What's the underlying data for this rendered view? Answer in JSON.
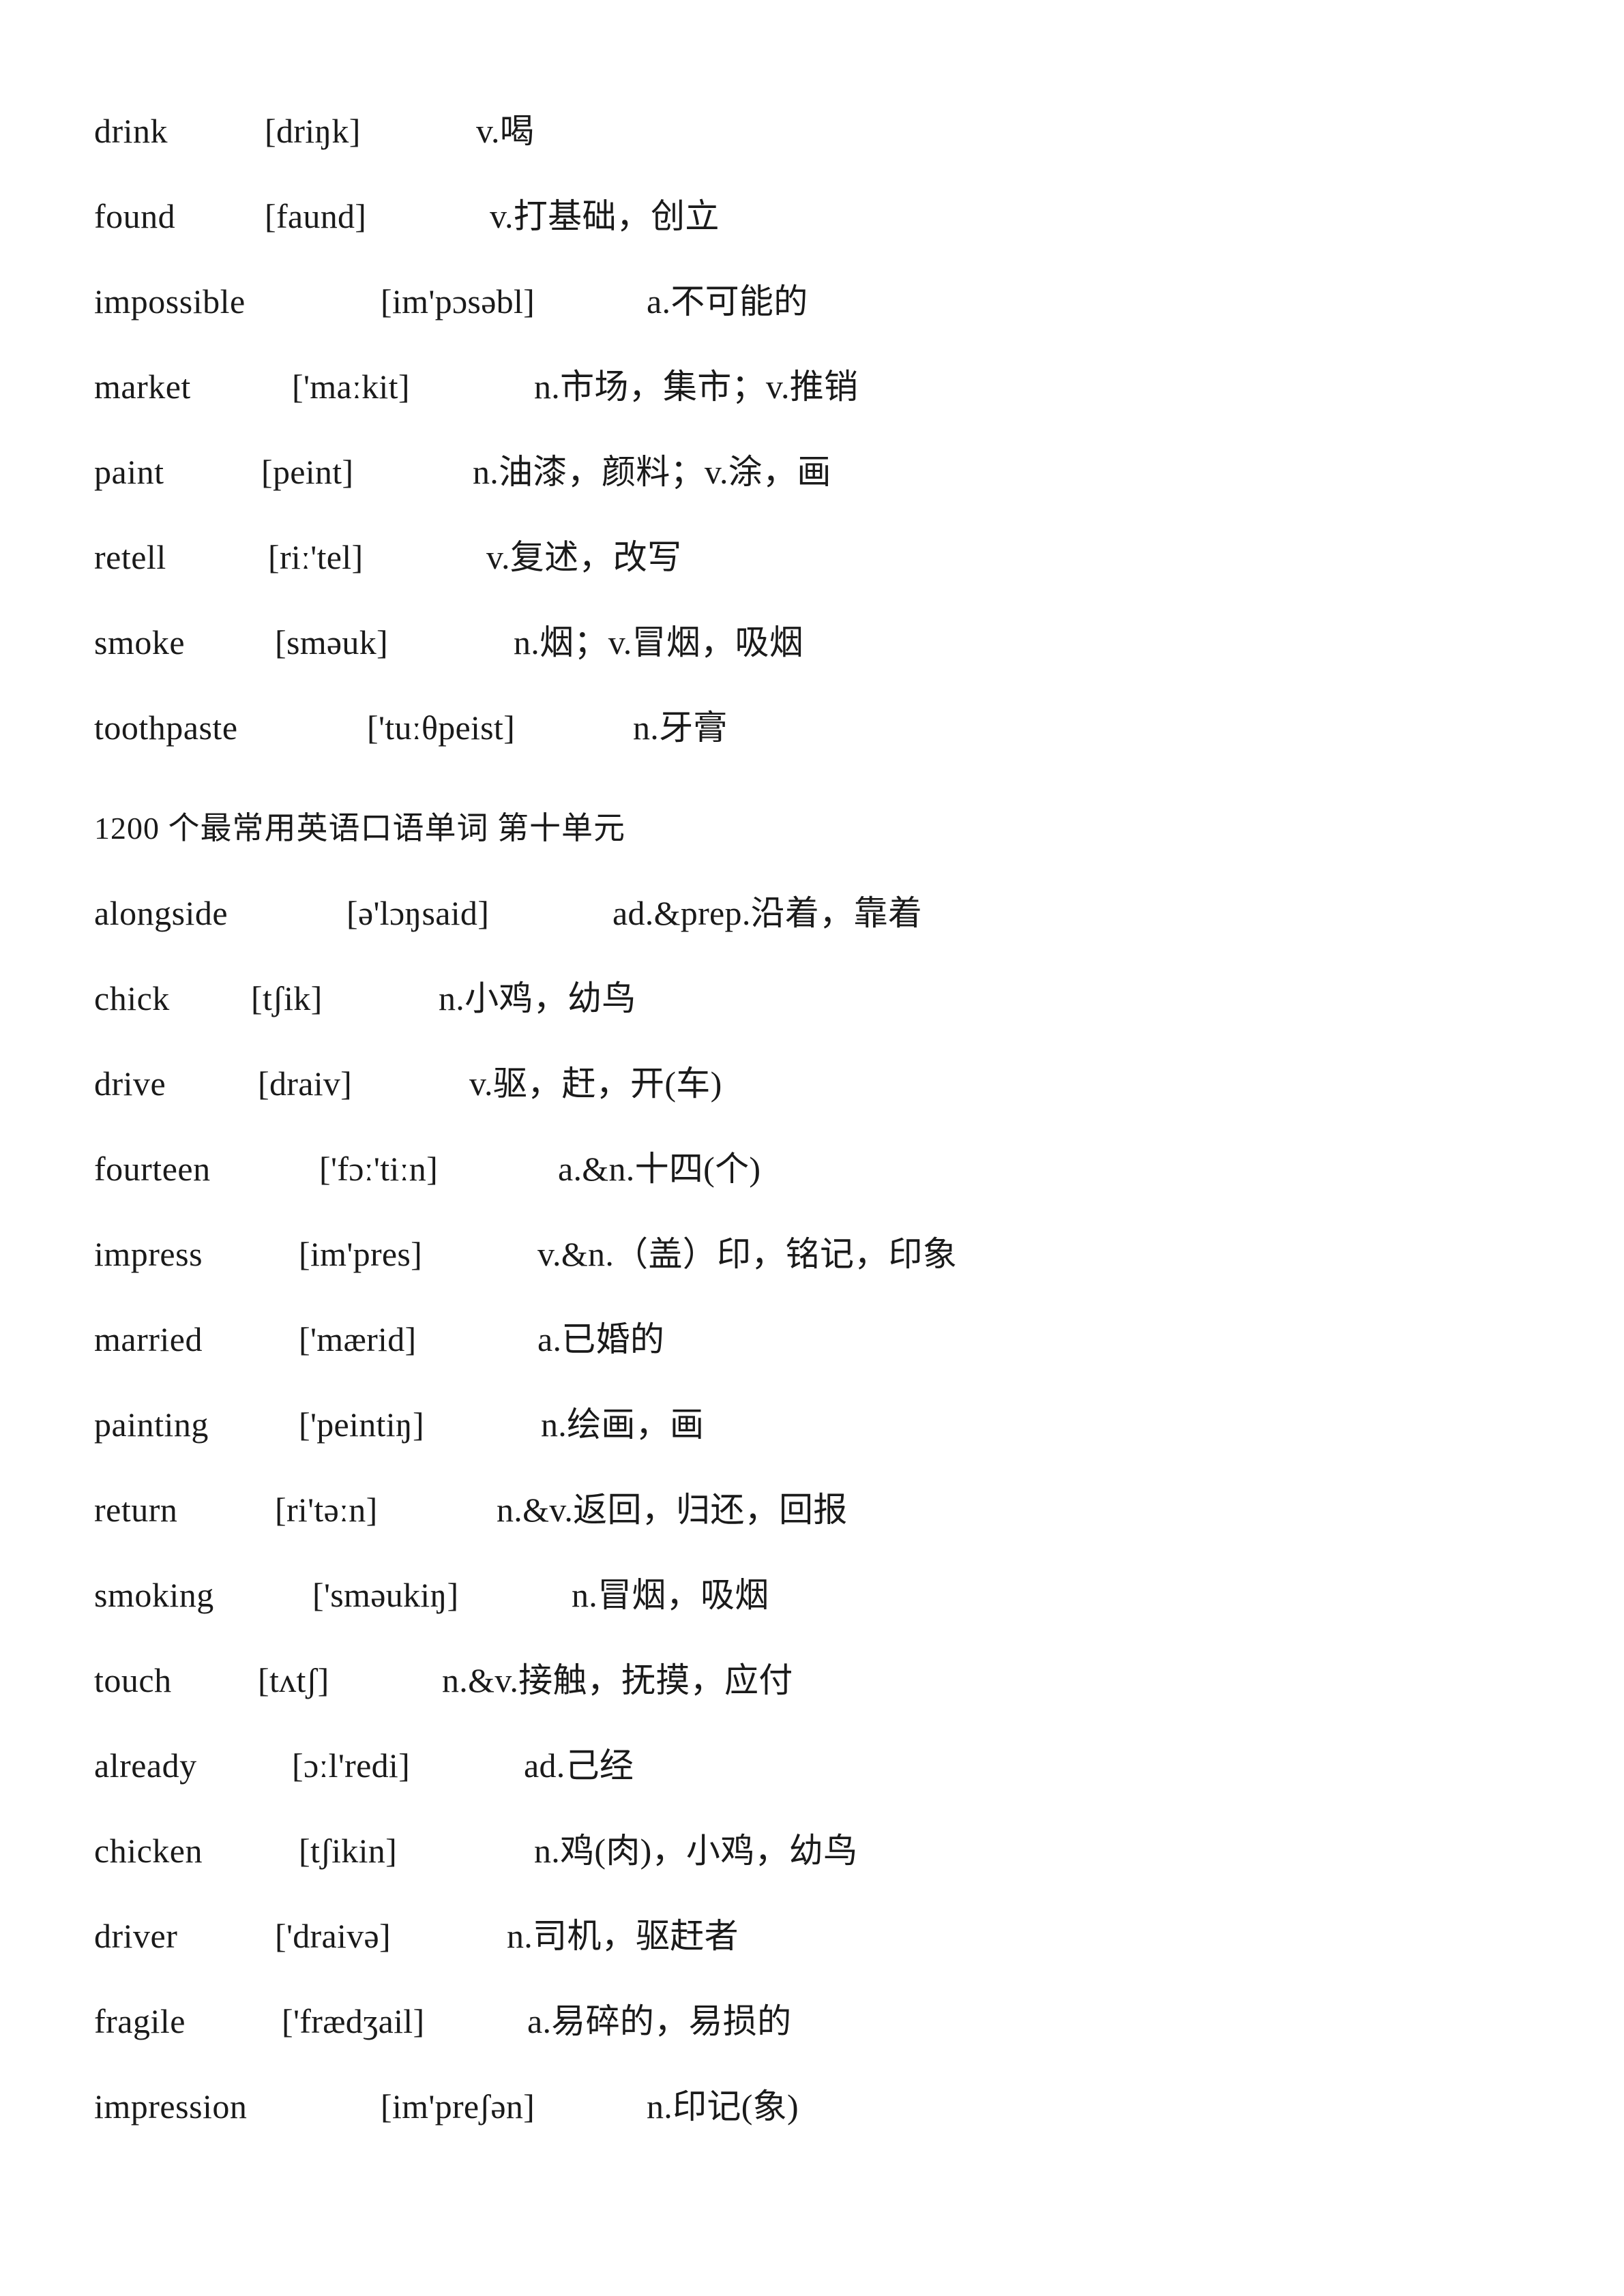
{
  "document": {
    "section_heading": "1200 个最常用英语口语单词 第十单元",
    "groups": [
      {
        "id": "group-top",
        "entries": [
          {
            "word": "drink",
            "phonetic": "[driŋk]",
            "definition": "v.喝",
            "word_w": 250,
            "phon_w": 310
          },
          {
            "word": "found",
            "phonetic": "[faund]",
            "definition": "v.打基础，创立",
            "word_w": 250,
            "phon_w": 330
          },
          {
            "word": "impossible",
            "phonetic": "[im'pɔsəbl]",
            "definition": "a.不可能的",
            "word_w": 420,
            "phon_w": 390
          },
          {
            "word": "market",
            "phonetic": "['maːkit]",
            "definition": "n.市场，集市；v.推销",
            "word_w": 290,
            "phon_w": 355
          },
          {
            "word": "paint",
            "phonetic": "[peint]",
            "definition": "n.油漆，颜料；v.涂，画",
            "word_w": 245,
            "phon_w": 310
          },
          {
            "word": "retell",
            "phonetic": "[riː'tel]",
            "definition": "v.复述，改写",
            "word_w": 255,
            "phon_w": 320
          },
          {
            "word": "smoke",
            "phonetic": "[smәuk]",
            "definition": "n.烟；v.冒烟，吸烟",
            "word_w": 265,
            "phon_w": 350
          },
          {
            "word": "toothpaste",
            "phonetic": "['tuːθpeist]",
            "definition": "n.牙膏",
            "word_w": 400,
            "phon_w": 390
          }
        ]
      },
      {
        "id": "group-unit-ten",
        "entries": [
          {
            "word": "alongside",
            "phonetic": "[ә'lɔŋsaid]",
            "definition": "ad.&prep.沿着，靠着",
            "word_w": 370,
            "phon_w": 390
          },
          {
            "word": "chick",
            "phonetic": "[tʃik]",
            "definition": "n.小鸡，幼鸟",
            "word_w": 230,
            "phon_w": 275
          },
          {
            "word": "drive",
            "phonetic": "[draiv]",
            "definition": "v.驱，赶，开(车)",
            "word_w": 240,
            "phon_w": 310
          },
          {
            "word": "fourteen",
            "phonetic": "['fɔː'tiːn]",
            "definition": "a.&n.十四(个)",
            "word_w": 330,
            "phon_w": 350
          },
          {
            "word": "impress",
            "phonetic": "[im'pres]",
            "definition": "v.&n.（盖）印，铭记，印象",
            "word_w": 300,
            "phon_w": 350
          },
          {
            "word": "married",
            "phonetic": "['mærid]",
            "definition": "a.已婚的",
            "word_w": 300,
            "phon_w": 350
          },
          {
            "word": "painting",
            "phonetic": "['peintiŋ]",
            "definition": "n.绘画，画",
            "word_w": 300,
            "phon_w": 355
          },
          {
            "word": "return",
            "phonetic": "[ri'tәːn]",
            "definition": "n.&v.返回，归还，回报",
            "word_w": 265,
            "phon_w": 325
          },
          {
            "word": "smoking",
            "phonetic": "['smәukiŋ]",
            "definition": "n.冒烟，吸烟",
            "word_w": 320,
            "phon_w": 380
          },
          {
            "word": "touch",
            "phonetic": "[tʌtʃ]",
            "definition": "n.&v.接触，抚摸，应付",
            "word_w": 240,
            "phon_w": 270
          },
          {
            "word": "already",
            "phonetic": "[ɔːl'redi]",
            "definition": "ad.己经",
            "word_w": 290,
            "phon_w": 340
          },
          {
            "word": "chicken",
            "phonetic": "[tʃikin]",
            "definition": "n.鸡(肉)，小鸡，幼鸟",
            "word_w": 300,
            "phon_w": 345
          },
          {
            "word": "driver",
            "phonetic": "['draivә]",
            "definition": "n.司机，驱赶者",
            "word_w": 265,
            "phon_w": 340
          },
          {
            "word": "fragile",
            "phonetic": "['frædʒail]",
            "definition": "a.易碎的，易损的",
            "word_w": 275,
            "phon_w": 360
          },
          {
            "word": "impression",
            "phonetic": "[im'preʃәn]",
            "definition": "n.印记(象)",
            "word_w": 420,
            "phon_w": 390
          }
        ]
      }
    ]
  },
  "colors": {
    "page_background": "#ffffff",
    "text": "#1a1a1a"
  }
}
